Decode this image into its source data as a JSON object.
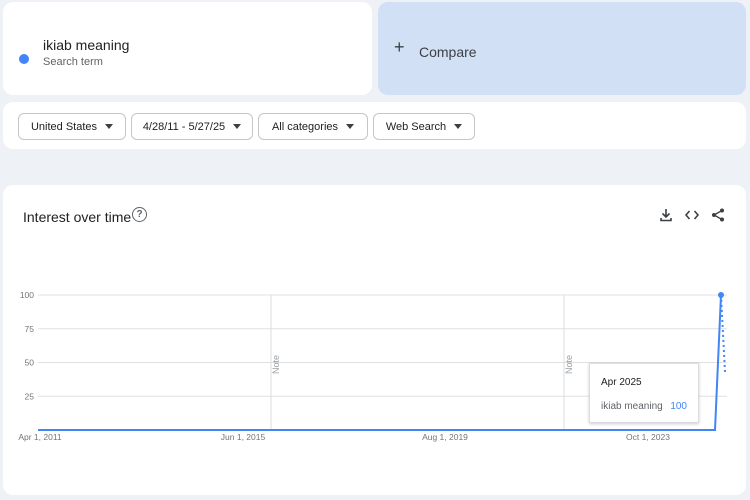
{
  "search_term": {
    "name": "ikiab meaning",
    "subtitle": "Search term",
    "color": "#4285f4"
  },
  "compare": {
    "label": "Compare",
    "icon": "plus-icon"
  },
  "filters": [
    {
      "label": "United States"
    },
    {
      "label": "4/28/11 - 5/27/25"
    },
    {
      "label": "All categories"
    },
    {
      "label": "Web Search"
    }
  ],
  "chart": {
    "title": "Interest over time",
    "help_icon": "help-icon"
  },
  "toolbar_icons": [
    "download-icon",
    "embed-code-icon",
    "share-icon"
  ],
  "chart_data": {
    "type": "line",
    "title": "Interest over time",
    "xlabel": "",
    "ylabel": "",
    "ylim": [
      0,
      100
    ],
    "y_ticks": [
      "100",
      "75",
      "50",
      "25"
    ],
    "x_ticks": [
      "Apr 1, 2011",
      "Jun 1, 2015",
      "Aug 1, 2019",
      "Oct 1, 2023"
    ],
    "notes": [
      "Note",
      "Note"
    ],
    "series": [
      {
        "name": "ikiab meaning",
        "color": "#4285f4",
        "flat_value": 0,
        "peak_label": "Apr 2025",
        "peak_value": 100
      }
    ],
    "grid": true
  },
  "tooltip": {
    "date": "Apr 2025",
    "term": "ikiab meaning",
    "value": "100"
  }
}
